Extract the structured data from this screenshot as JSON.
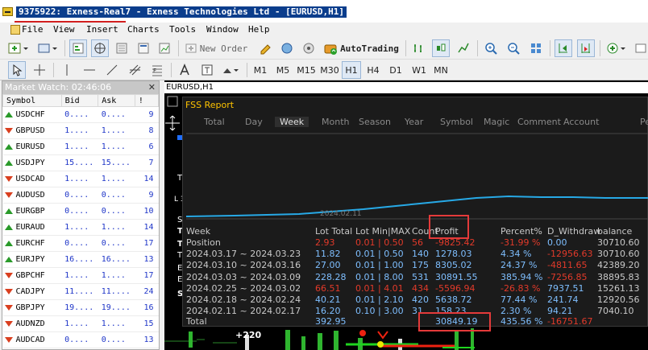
{
  "window": {
    "title": "9375922: Exness-Real7 - Exness Technologies Ltd - [EURUSD,H1]"
  },
  "menu": [
    "File",
    "View",
    "Insert",
    "Charts",
    "Tools",
    "Window",
    "Help"
  ],
  "toolbar": {
    "new_order": "New Order",
    "autotrading": "AutoTrading"
  },
  "timeframes": [
    "M1",
    "M5",
    "M15",
    "M30",
    "H1",
    "H4",
    "D1",
    "W1",
    "MN"
  ],
  "active_timeframe": "H1",
  "market_watch": {
    "title": "Market Watch: 02:46:06",
    "columns": [
      "Symbol",
      "Bid",
      "Ask",
      "!"
    ],
    "rows": [
      {
        "symbol": "USDCHF",
        "bid": "0....",
        "ask": "0....",
        "spread": "9",
        "dir": "up"
      },
      {
        "symbol": "GBPUSD",
        "bid": "1....",
        "ask": "1....",
        "spread": "8",
        "dir": "down"
      },
      {
        "symbol": "EURUSD",
        "bid": "1....",
        "ask": "1....",
        "spread": "6",
        "dir": "up"
      },
      {
        "symbol": "USDJPY",
        "bid": "15....",
        "ask": "15....",
        "spread": "7",
        "dir": "up"
      },
      {
        "symbol": "USDCAD",
        "bid": "1....",
        "ask": "1....",
        "spread": "14",
        "dir": "down"
      },
      {
        "symbol": "AUDUSD",
        "bid": "0....",
        "ask": "0....",
        "spread": "9",
        "dir": "down"
      },
      {
        "symbol": "EURGBP",
        "bid": "0....",
        "ask": "0....",
        "spread": "10",
        "dir": "up"
      },
      {
        "symbol": "EURAUD",
        "bid": "1....",
        "ask": "1....",
        "spread": "14",
        "dir": "up"
      },
      {
        "symbol": "EURCHF",
        "bid": "0....",
        "ask": "0....",
        "spread": "17",
        "dir": "up"
      },
      {
        "symbol": "EURJPY",
        "bid": "16....",
        "ask": "16....",
        "spread": "13",
        "dir": "up"
      },
      {
        "symbol": "GBPCHF",
        "bid": "1....",
        "ask": "1....",
        "spread": "17",
        "dir": "down"
      },
      {
        "symbol": "CADJPY",
        "bid": "11....",
        "ask": "11....",
        "spread": "24",
        "dir": "down"
      },
      {
        "symbol": "GBPJPY",
        "bid": "19....",
        "ask": "19....",
        "spread": "16",
        "dir": "down"
      },
      {
        "symbol": "AUDNZD",
        "bid": "1....",
        "ask": "1....",
        "spread": "15",
        "dir": "down"
      },
      {
        "symbol": "AUDCAD",
        "bid": "0....",
        "ask": "0....",
        "spread": "13",
        "dir": "down"
      }
    ]
  },
  "chart": {
    "title": "EURUSD,H1"
  },
  "fss": {
    "title": "FSS Report",
    "tabs": [
      "Total",
      "Day",
      "Week",
      "Month",
      "Season",
      "Year",
      "Symbol",
      "Magic",
      "Comment",
      "Account",
      "Pe"
    ],
    "active_tab": "Week",
    "axis_date": "2024.02.11",
    "headers": [
      "Week",
      "Lot Total",
      "Lot Min|MAX",
      "Count",
      "Profit",
      "Percent%",
      "D_Withdraw",
      "balance"
    ],
    "rows": [
      {
        "week": "Position",
        "lot_total": "2.93",
        "lot_minmax": "0.01 | 0.50",
        "count": "56",
        "profit": "-9825.42",
        "percent": "-31.99 %",
        "withdraw": "0.00",
        "balance": "30710.60",
        "neg": true,
        "wneg": false
      },
      {
        "week": "2024.03.17 ~ 2024.03.23",
        "lot_total": "11.82",
        "lot_minmax": "0.01 | 0.50",
        "count": "140",
        "profit": "1278.03",
        "percent": "4.34 %",
        "withdraw": "-12956.63",
        "balance": "30710.60",
        "neg": false,
        "wneg": true
      },
      {
        "week": "2024.03.10 ~ 2024.03.16",
        "lot_total": "27.00",
        "lot_minmax": "0.01 | 1.00",
        "count": "175",
        "profit": "8305.02",
        "percent": "24.37 %",
        "withdraw": "-4811.65",
        "balance": "42389.20",
        "neg": false,
        "wneg": true
      },
      {
        "week": "2024.03.03 ~ 2024.03.09",
        "lot_total": "228.28",
        "lot_minmax": "0.01 | 8.00",
        "count": "531",
        "profit": "30891.55",
        "percent": "385.94 %",
        "withdraw": "-7256.85",
        "balance": "38895.83",
        "neg": false,
        "wneg": true
      },
      {
        "week": "2024.02.25 ~ 2024.03.02",
        "lot_total": "66.51",
        "lot_minmax": "0.01 | 4.01",
        "count": "434",
        "profit": "-5596.94",
        "percent": "-26.83 %",
        "withdraw": "7937.51",
        "balance": "15261.13",
        "neg": true,
        "wneg": false
      },
      {
        "week": "2024.02.18 ~ 2024.02.24",
        "lot_total": "40.21",
        "lot_minmax": "0.01 | 2.10",
        "count": "420",
        "profit": "5638.72",
        "percent": "77.44 %",
        "withdraw": "241.74",
        "balance": "12920.56",
        "neg": false,
        "wneg": false
      },
      {
        "week": "2024.02.11 ~ 2024.02.17",
        "lot_total": "16.20",
        "lot_minmax": "0.10 | 3.00",
        "count": "31",
        "profit": "158.23",
        "percent": "2.30 %",
        "withdraw": "94.21",
        "balance": "7040.10",
        "neg": false,
        "wneg": false
      }
    ],
    "total": {
      "label": "Total",
      "lot_total": "392.95",
      "profit": "30849.19",
      "percent": "435.56 %",
      "withdraw": "-16751.67"
    }
  },
  "chart_label": "+220",
  "colors": {
    "accent": "#7fbfff",
    "negative": "#e23a2a",
    "header": "#ffc400",
    "highlight": "#e43a3a"
  }
}
